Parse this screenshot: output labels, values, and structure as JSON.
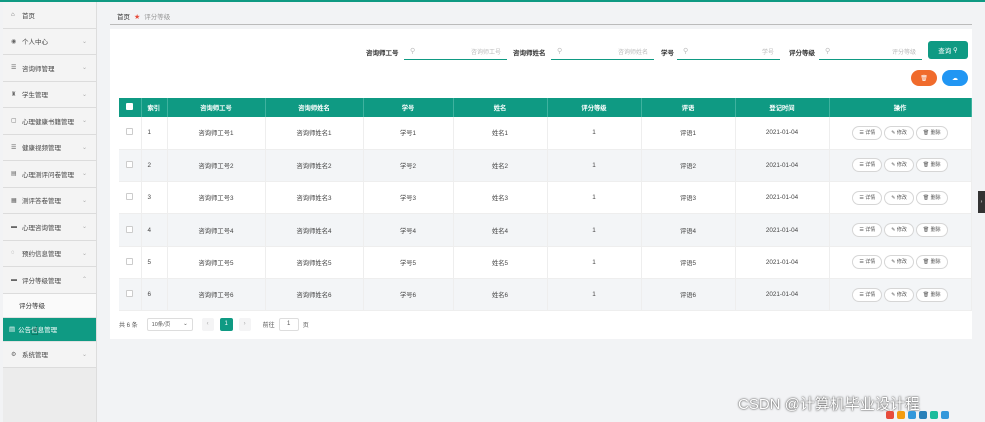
{
  "colors": {
    "accent": "#0f9a83",
    "danger": "#f06b2c",
    "primary": "#2196f3"
  },
  "sidebar": {
    "items": [
      {
        "icon": "home-icon",
        "label": "首页"
      },
      {
        "icon": "user-icon",
        "label": "个人中心"
      },
      {
        "icon": "list-icon",
        "label": "咨询师管理"
      },
      {
        "icon": "student-icon",
        "label": "学生管理"
      },
      {
        "icon": "book-icon",
        "label": "心理健康书籍管理"
      },
      {
        "icon": "list-icon",
        "label": "健康视频管理"
      },
      {
        "icon": "trash-icon",
        "label": "心理测评问卷管理"
      },
      {
        "icon": "grid-icon",
        "label": "测评答卷管理"
      },
      {
        "icon": "chat-icon",
        "label": "心理咨询管理"
      },
      {
        "icon": "calendar-icon",
        "label": "预约信息管理"
      },
      {
        "icon": "chat-icon",
        "label": "评分等级管理"
      }
    ],
    "subitems": [
      "评分等级",
      "公告信息管理"
    ],
    "last": {
      "icon": "settings-icon",
      "label": "系统管理"
    }
  },
  "breadcrumb": {
    "home": "首页",
    "current": "评分等级"
  },
  "filters": [
    {
      "label": "咨询师工号",
      "placeholder": "咨询师工号"
    },
    {
      "label": "咨询师姓名",
      "placeholder": "咨询师姓名"
    },
    {
      "label": "学号",
      "placeholder": "学号"
    },
    {
      "label": "评分等级",
      "placeholder": "评分等级"
    }
  ],
  "search_button": "查询",
  "table": {
    "headers": [
      "索引",
      "咨询师工号",
      "咨询师姓名",
      "学号",
      "姓名",
      "评分等级",
      "评语",
      "登记时间",
      "操作"
    ],
    "rows": [
      [
        "1",
        "咨询师工号1",
        "咨询师姓名1",
        "学号1",
        "姓名1",
        "1",
        "评语1",
        "2021-01-04"
      ],
      [
        "2",
        "咨询师工号2",
        "咨询师姓名2",
        "学号2",
        "姓名2",
        "1",
        "评语2",
        "2021-01-04"
      ],
      [
        "3",
        "咨询师工号3",
        "咨询师姓名3",
        "学号3",
        "姓名3",
        "1",
        "评语3",
        "2021-01-04"
      ],
      [
        "4",
        "咨询师工号4",
        "咨询师姓名4",
        "学号4",
        "姓名4",
        "1",
        "评语4",
        "2021-01-04"
      ],
      [
        "5",
        "咨询师工号5",
        "咨询师姓名5",
        "学号5",
        "姓名5",
        "1",
        "评语5",
        "2021-01-04"
      ],
      [
        "6",
        "咨询师工号6",
        "咨询师姓名6",
        "学号6",
        "姓名6",
        "1",
        "评语6",
        "2021-01-04"
      ]
    ],
    "actions": [
      "详情",
      "修改",
      "删除"
    ]
  },
  "pagination": {
    "total": "共 6 条",
    "page_size": "10条/页",
    "current": "1",
    "goto": "前往",
    "goto_value": "1",
    "unit": "页"
  },
  "watermark": "CSDN @计算机毕业设计程"
}
